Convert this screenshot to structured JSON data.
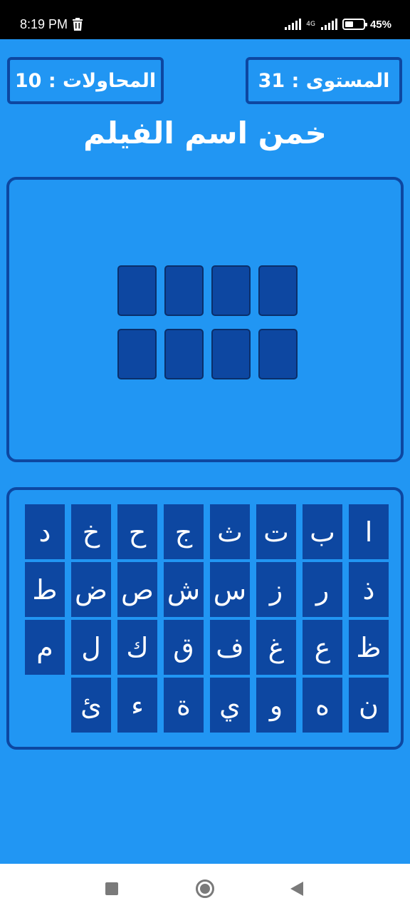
{
  "status_bar": {
    "time": "8:19 PM",
    "network": "4G",
    "battery": "45%"
  },
  "header": {
    "level_text": "المستوى : 31",
    "attempts_text": "المحاولات : 10"
  },
  "title": "خمن اسم الفيلم",
  "answer": {
    "slots_row1": 4,
    "slots_row2": 4
  },
  "keyboard": {
    "rows": [
      [
        "ا",
        "ب",
        "ت",
        "ث",
        "ج",
        "ح",
        "خ",
        "د"
      ],
      [
        "ذ",
        "ر",
        "ز",
        "س",
        "ش",
        "ص",
        "ض",
        "ط"
      ],
      [
        "ظ",
        "ع",
        "غ",
        "ف",
        "ق",
        "ك",
        "ل",
        "م"
      ],
      [
        "ن",
        "ه",
        "و",
        "ي",
        "ة",
        "ء",
        "ئ"
      ]
    ]
  },
  "colors": {
    "background": "#2196f3",
    "panel_border": "#0d47a1",
    "tile": "#0d47a1",
    "text": "#ffffff"
  },
  "icons": {
    "status": [
      "trash-icon",
      "signal-icon",
      "battery-icon"
    ],
    "nav": [
      "recent-apps-icon",
      "home-icon",
      "back-icon"
    ]
  }
}
